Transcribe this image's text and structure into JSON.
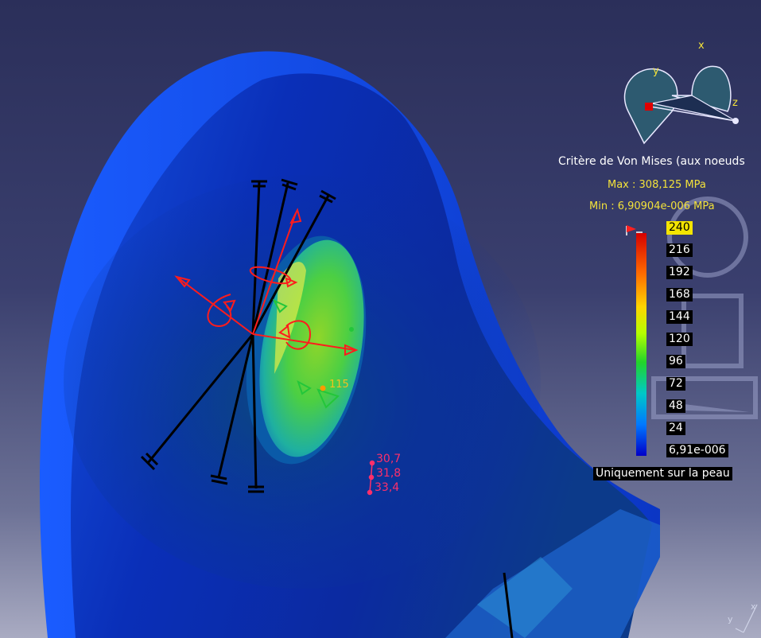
{
  "legend": {
    "title": "Critère de Von Mises (aux noeuds",
    "max_label": "Max : 308,125 MPa",
    "min_label": "Min : 6,90904e-006 MPa",
    "ticks": [
      "240",
      "216",
      "192",
      "168",
      "144",
      "120",
      "96",
      "72",
      "48",
      "24",
      "6,91e-006"
    ],
    "highlighted_tick": "240",
    "skin_label": "Uniquement sur la peau"
  },
  "compass": {
    "x_label": "x",
    "y_label": "y",
    "z_label": "z"
  },
  "annotations": {
    "point_value": "115",
    "stack_values": [
      "30,7",
      "31,8",
      "33,4"
    ]
  },
  "corner_axes": {
    "x_label": "x",
    "y_label": "y"
  },
  "colors": {
    "scale_top": "#d40000",
    "scale_bottom": "#0000c8",
    "annotation_pink": "#ff2f6a",
    "legend_yellow": "#f3e23a"
  }
}
